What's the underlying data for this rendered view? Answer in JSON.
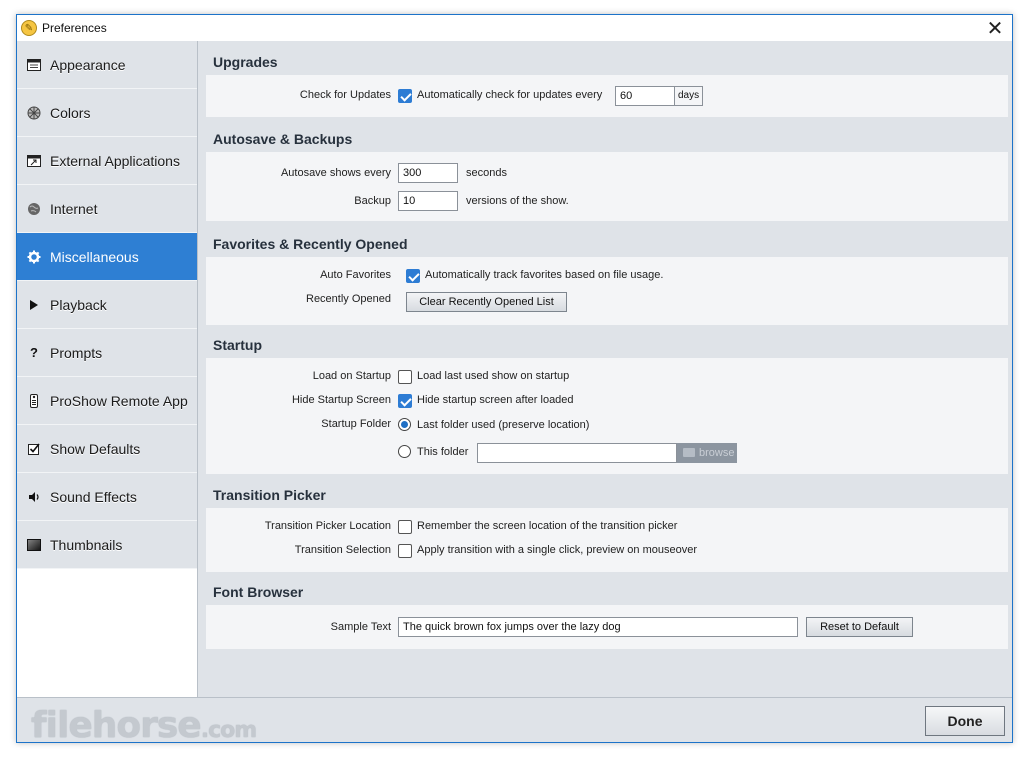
{
  "window": {
    "title": "Preferences"
  },
  "sidebar": {
    "items": [
      {
        "label": "Appearance",
        "icon": "appearance-icon"
      },
      {
        "label": "Colors",
        "icon": "colors-icon"
      },
      {
        "label": "External Applications",
        "icon": "external-apps-icon"
      },
      {
        "label": "Internet",
        "icon": "globe-icon"
      },
      {
        "label": "Miscellaneous",
        "icon": "gear-icon",
        "active": true
      },
      {
        "label": "Playback",
        "icon": "play-icon"
      },
      {
        "label": "Prompts",
        "icon": "question-icon"
      },
      {
        "label": "ProShow Remote App",
        "icon": "remote-icon"
      },
      {
        "label": "Show Defaults",
        "icon": "checkbox-icon"
      },
      {
        "label": "Sound Effects",
        "icon": "speaker-icon"
      },
      {
        "label": "Thumbnails",
        "icon": "thumbnail-icon"
      }
    ]
  },
  "upgrades": {
    "title": "Upgrades",
    "check_label": "Check for Updates",
    "check_text": "Automatically check for updates every",
    "check_checked": true,
    "days_value": "60",
    "days_unit": "days"
  },
  "autosave": {
    "title": "Autosave & Backups",
    "autosave_label": "Autosave shows every",
    "autosave_value": "300",
    "autosave_unit": "seconds",
    "backup_label": "Backup",
    "backup_value": "10",
    "backup_unit": "versions of the show."
  },
  "favorites": {
    "title": "Favorites & Recently Opened",
    "auto_label": "Auto Favorites",
    "auto_text": "Automatically track favorites based on file usage.",
    "auto_checked": true,
    "recent_label": "Recently Opened",
    "clear_button": "Clear Recently Opened List"
  },
  "startup": {
    "title": "Startup",
    "load_label": "Load on Startup",
    "load_text": "Load last used show on startup",
    "load_checked": false,
    "hide_label": "Hide Startup Screen",
    "hide_text": "Hide startup screen after loaded",
    "hide_checked": true,
    "folder_label": "Startup Folder",
    "last_folder_text": "Last folder used (preserve location)",
    "this_folder_text": "This folder",
    "selected_option": "last_folder",
    "folder_value": "",
    "browse_label": "browse"
  },
  "transition": {
    "title": "Transition Picker",
    "location_label": "Transition Picker Location",
    "location_text": "Remember the screen location of the transition picker",
    "location_checked": false,
    "selection_label": "Transition Selection",
    "selection_text": "Apply transition with a single click, preview on mouseover",
    "selection_checked": false
  },
  "font": {
    "title": "Font Browser",
    "sample_label": "Sample Text",
    "sample_value": "The quick brown fox jumps over the lazy dog",
    "reset_button": "Reset to Default"
  },
  "footer": {
    "done_button": "Done",
    "watermark_main": "filehorse",
    "watermark_suffix": ".com"
  },
  "colors": {
    "accent": "#2e7fd3",
    "checkbox": "#2d7cd4",
    "panel_bg": "#f4f5f7",
    "content_bg": "#dfe3e8"
  }
}
